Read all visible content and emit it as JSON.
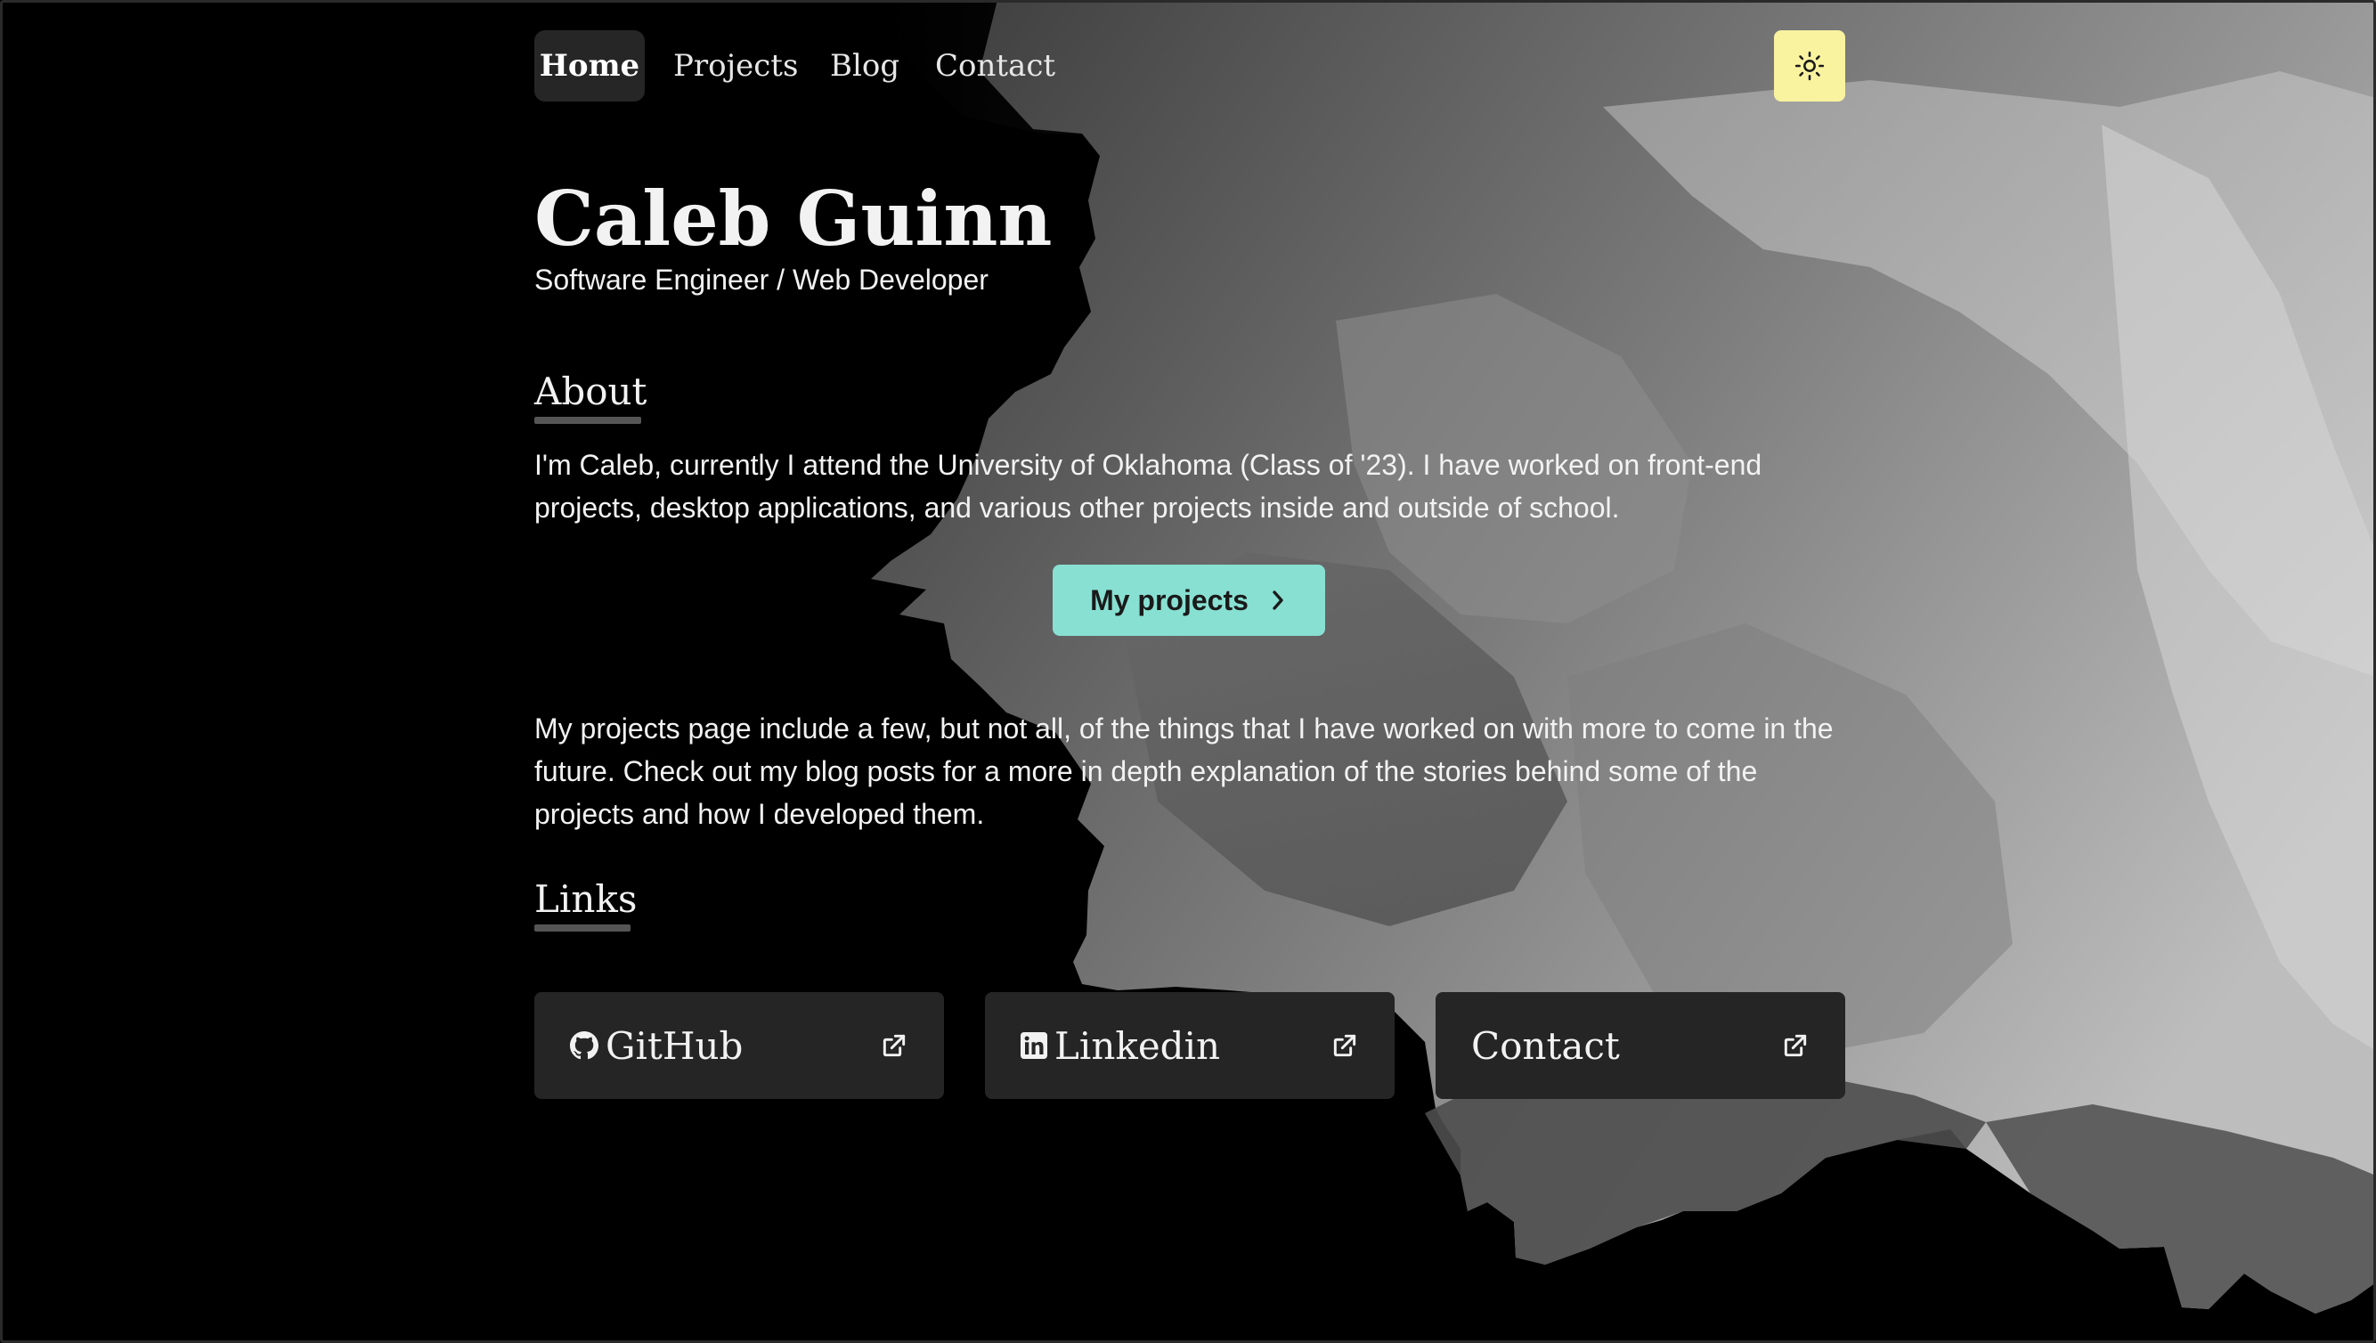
{
  "nav": {
    "items": [
      {
        "label": "Home",
        "active": true
      },
      {
        "label": "Projects",
        "active": false
      },
      {
        "label": "Blog",
        "active": false
      },
      {
        "label": "Contact",
        "active": false
      }
    ],
    "theme_toggle_icon": "sun-icon"
  },
  "header": {
    "name": "Caleb Guinn",
    "subtitle": "Software Engineer / Web Developer"
  },
  "about": {
    "heading": "About",
    "text": "I'm Caleb, currently I attend the University of Oklahoma (Class of '23). I have worked on front-end projects, desktop applications, and various other projects inside and outside of school.",
    "button_label": "My projects",
    "button_icon": "chevron-right-icon",
    "more_text": "My projects page include a few, but not all, of the things that I have worked on with more to come in the future. Check out my blog posts for a more in depth explanation of the stories behind some of the projects and how I developed them."
  },
  "links": {
    "heading": "Links",
    "cards": [
      {
        "label": "GitHub",
        "icon": "github-icon",
        "external_icon": "external-link-icon"
      },
      {
        "label": "Linkedin",
        "icon": "linkedin-icon",
        "external_icon": "external-link-icon"
      },
      {
        "label": "Contact",
        "icon": "",
        "external_icon": "external-link-icon"
      }
    ]
  },
  "colors": {
    "background": "#000000",
    "accent_button": "#88e0d2",
    "theme_toggle": "#f9f3a0",
    "card_background": "#252525",
    "text": "#f2f2f2"
  }
}
